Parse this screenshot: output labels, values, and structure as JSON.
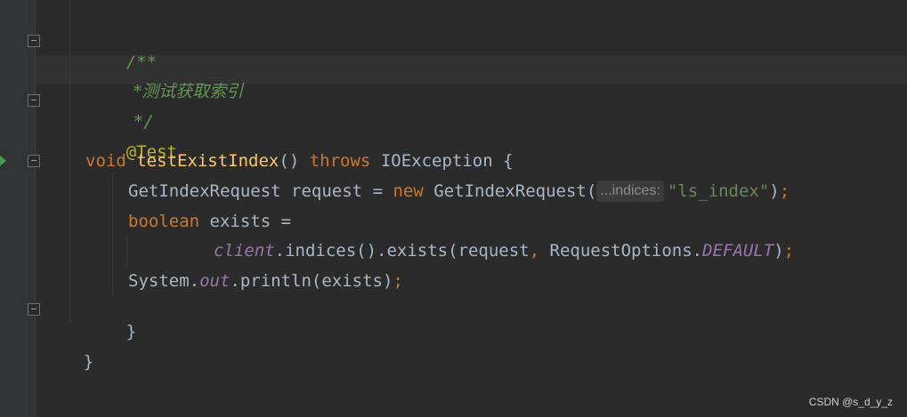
{
  "editor": {
    "lines": {
      "comment_open": "/**",
      "comment_body": "*测试获取索引",
      "comment_close": "*/",
      "annotation": "@Test",
      "method": {
        "return_type": "void",
        "name": "testExistIndex",
        "params": "()",
        "throws_kw": "throws",
        "exception": "IOException",
        "brace": "{"
      },
      "request_line": {
        "type": "GetIndexRequest",
        "var": "request",
        "eq": "=",
        "new_kw": "new",
        "ctor": "GetIndexRequest(",
        "hint": "...indices:",
        "arg": "\"ls_index\"",
        "close": ")",
        "semi": ";"
      },
      "exists_line": {
        "type_kw": "boolean",
        "rest": "exists ="
      },
      "client_line": {
        "field": "client",
        "call": ".indices().exists(request",
        "comma": ",",
        "cls": "RequestOptions.",
        "constant": "DEFAULT",
        "close": ")",
        "semi": ";"
      },
      "print_line": {
        "cls": "System.",
        "field": "out",
        "call": ".println(exists)",
        "semi": ";"
      },
      "method_close": "}",
      "class_close": "}"
    }
  },
  "watermark": "CSDN @s_d_y_z",
  "colors": {
    "background": "#2b2b2b",
    "gutter": "#313335",
    "comment": "#629755",
    "keyword": "#cc7832",
    "method_decl": "#ffc66d",
    "annotation": "#bbb529",
    "string": "#6a8759",
    "field": "#9876aa",
    "text": "#a9b7c6",
    "run_icon": "#499c54"
  },
  "icons": [
    "fold-marker-icon",
    "run-gutter-icon"
  ]
}
